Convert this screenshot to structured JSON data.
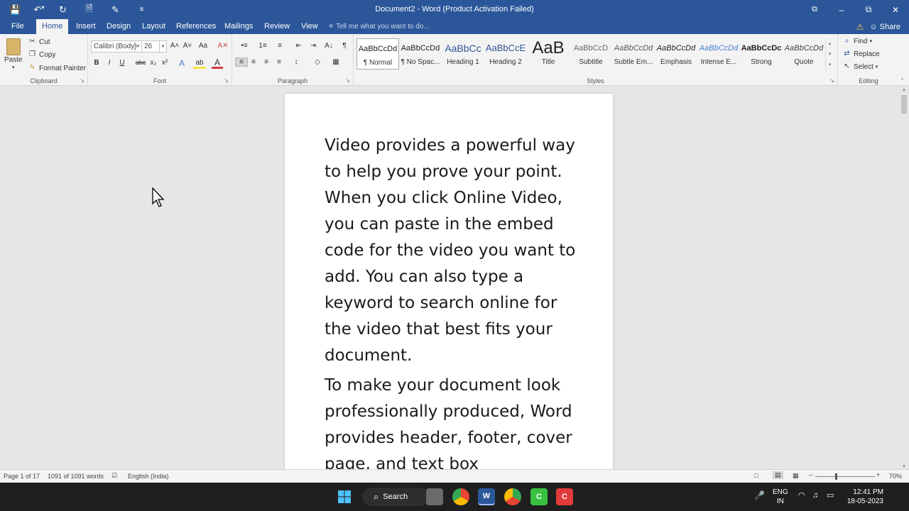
{
  "window": {
    "title": "Document2 - Word (Product Activation Failed)",
    "accent": "#2b579a"
  },
  "qat": {
    "save_icon": "💾",
    "undo_icon": "↶",
    "undo_arrow": "▾",
    "redo_icon": "↻",
    "new_icon": "🗎",
    "form_icon": "✎",
    "more_icon": "≡"
  },
  "tabs": [
    "File",
    "Home",
    "Insert",
    "Design",
    "Layout",
    "References",
    "Mailings",
    "Review",
    "View"
  ],
  "tell_me": "Tell me what you want to do...",
  "share_label": "Share",
  "clipboard": {
    "paste": "Paste",
    "cut": "Cut",
    "copy": "Copy",
    "format_painter": "Format Painter",
    "group_label": "Clipboard"
  },
  "font": {
    "family": "Calibri (Body)",
    "size": "26",
    "group_label": "Font",
    "grow": "A˄",
    "shrink": "A˅",
    "case": "Aa",
    "clear": "A✕",
    "bold": "B",
    "italic": "I",
    "underline": "U",
    "strike": "abc",
    "subscript": "x₂",
    "superscript": "x²",
    "effects": "A",
    "highlight": "ab",
    "color": "A"
  },
  "paragraph": {
    "group_label": "Paragraph",
    "bullets": "•≡",
    "numbering": "1≡",
    "multilevel": "≡",
    "decrease_indent": "⇤",
    "increase_indent": "⇥",
    "sort": "A↓",
    "pilcrow": "¶",
    "align_left": "≡",
    "center": "≡",
    "align_right": "≡",
    "justify": "≡",
    "line_spacing": "↕",
    "shading": "◇",
    "borders": "▦"
  },
  "styles": {
    "group_label": "Styles",
    "items": [
      {
        "sample": "AaBbCcDd",
        "name": "¶ Normal"
      },
      {
        "sample": "AaBbCcDd",
        "name": "¶ No Spac..."
      },
      {
        "sample": "AaBbCc",
        "name": "Heading 1"
      },
      {
        "sample": "AaBbCcE",
        "name": "Heading 2"
      },
      {
        "sample": "AaB",
        "name": "Title"
      },
      {
        "sample": "AaBbCcD",
        "name": "Subtitle"
      },
      {
        "sample": "AaBbCcDd",
        "name": "Subtle Em..."
      },
      {
        "sample": "AaBbCcDd",
        "name": "Emphasis"
      },
      {
        "sample": "AaBbCcDd",
        "name": "Intense E..."
      },
      {
        "sample": "AaBbCcDc",
        "name": "Strong"
      },
      {
        "sample": "AaBbCcDd",
        "name": "Quote"
      }
    ]
  },
  "editing": {
    "group_label": "Editing",
    "find": "Find",
    "replace": "Replace",
    "select": "Select"
  },
  "document": {
    "paragraphs": [
      "Video provides a powerful way to help you prove your point. When you click Online Video, you can paste in the embed code for the video you want to add. You can also type a keyword to search online for the video that best fits your document.",
      "To make your document look professionally produced, Word provides header, footer, cover page, and text box"
    ]
  },
  "status": {
    "page": "Page 1 of 17",
    "words": "1091 of 1091 words",
    "language": "English (India)",
    "zoom": "70%"
  },
  "taskbar": {
    "search": "Search",
    "lang_top": "ENG",
    "lang_bottom": "IN",
    "time": "12:41 PM",
    "date": "18-05-2023"
  }
}
